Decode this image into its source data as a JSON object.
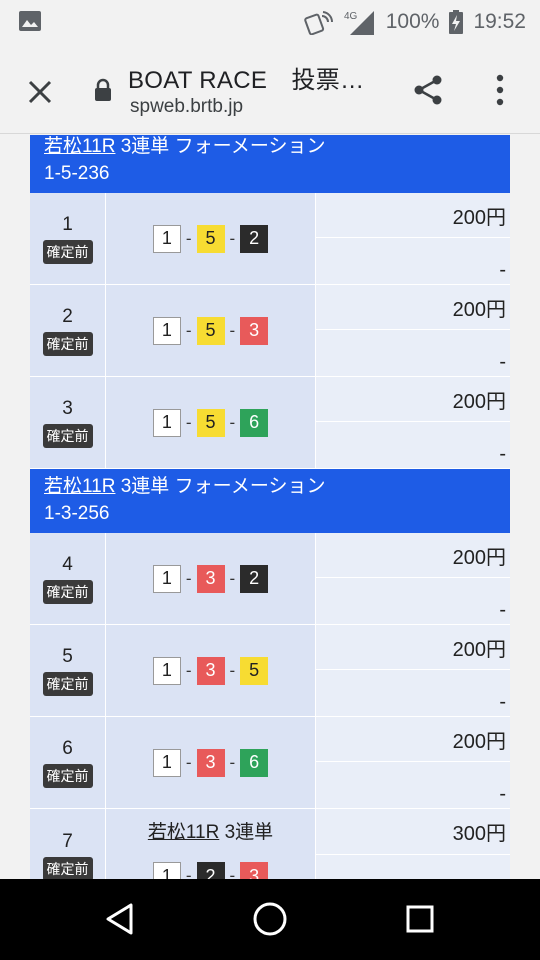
{
  "status": {
    "network": "4G",
    "battery": "100%",
    "time": "19:52"
  },
  "header": {
    "title": "BOAT RACE　投票…",
    "url": "spweb.brtb.jp"
  },
  "groups": [
    {
      "race": "若松11R",
      "type": "3連単 フォーメーション",
      "bet": "1-5-236"
    },
    {
      "race": "若松11R",
      "type": "3連単 フォーメーション",
      "bet": "1-3-256"
    }
  ],
  "rows": [
    {
      "num": "1",
      "status": "確定前",
      "combo": [
        "1",
        "5",
        "2"
      ],
      "amount": "200円",
      "payout": "-"
    },
    {
      "num": "2",
      "status": "確定前",
      "combo": [
        "1",
        "5",
        "3"
      ],
      "amount": "200円",
      "payout": "-"
    },
    {
      "num": "3",
      "status": "確定前",
      "combo": [
        "1",
        "5",
        "6"
      ],
      "amount": "200円",
      "payout": "-"
    },
    {
      "num": "4",
      "status": "確定前",
      "combo": [
        "1",
        "3",
        "2"
      ],
      "amount": "200円",
      "payout": "-"
    },
    {
      "num": "5",
      "status": "確定前",
      "combo": [
        "1",
        "3",
        "5"
      ],
      "amount": "200円",
      "payout": "-"
    },
    {
      "num": "6",
      "status": "確定前",
      "combo": [
        "1",
        "3",
        "6"
      ],
      "amount": "200円",
      "payout": "-"
    }
  ],
  "row7": {
    "num": "7",
    "status": "確定前",
    "race": "若松11R",
    "type": "3連単",
    "amount": "300円"
  },
  "colors": {
    "header_blue": "#1e5ce6",
    "boat_1": "#ffffff",
    "boat_2": "#2b2b2b",
    "boat_3": "#e85a5a",
    "boat_5": "#f7dc32",
    "boat_6": "#2ea35a"
  },
  "icons": [
    "image-icon",
    "nfc-icon",
    "signal-icon",
    "battery-charging-icon",
    "close-icon",
    "lock-icon",
    "share-icon",
    "more-vert-icon",
    "back-icon",
    "home-icon",
    "recents-icon"
  ]
}
